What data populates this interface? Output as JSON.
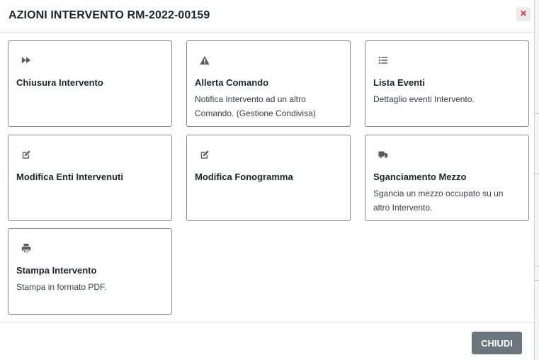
{
  "modal": {
    "title": "AZIONI INTERVENTO RM-2022-00159",
    "close_symbol": "×"
  },
  "cards": [
    {
      "icon": "forward-icon",
      "title": "Chiusura Intervento",
      "description": ""
    },
    {
      "icon": "warning-icon",
      "title": "Allerta Comando",
      "description": "Notifica Intervento ad un altro Comando. (Gestione Condivisa)"
    },
    {
      "icon": "list-icon",
      "title": "Lista Eventi",
      "description": "Dettaglio eventi Intervento."
    },
    {
      "icon": "edit-icon",
      "title": "Modifica Enti Intervenuti",
      "description": ""
    },
    {
      "icon": "edit-icon",
      "title": "Modifica Fonogramma",
      "description": ""
    },
    {
      "icon": "truck-icon",
      "title": "Sganciamento Mezzo",
      "description": "Sgancia un mezzo occupato su un altro Intervento."
    },
    {
      "icon": "print-icon",
      "title": "Stampa Intervento",
      "description": "Stampa in formato PDF."
    }
  ],
  "footer": {
    "close_label": "CHIUDI"
  },
  "colors": {
    "close_x": "#dc3545",
    "button_bg": "#6c757d",
    "card_border": "#8a8a8a"
  }
}
